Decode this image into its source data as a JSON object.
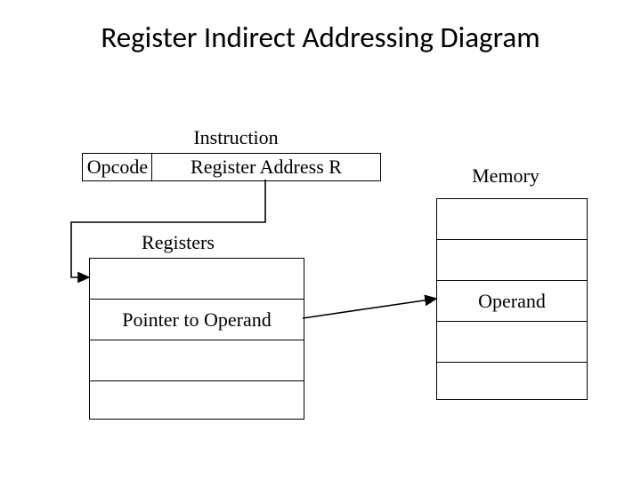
{
  "title": "Register Indirect Addressing Diagram",
  "labels": {
    "instruction": "Instruction",
    "registers": "Registers",
    "memory": "Memory"
  },
  "instruction": {
    "opcode": "Opcode",
    "regaddr": "Register Address R"
  },
  "register_cell_label": "Pointer to Operand",
  "memory_cell_label": "Operand",
  "chart_data": {
    "type": "diagram",
    "title": "Register Indirect Addressing Diagram",
    "nodes": [
      {
        "id": "instruction",
        "label": "Instruction",
        "fields": [
          "Opcode",
          "Register Address R"
        ]
      },
      {
        "id": "registers",
        "label": "Registers",
        "cells": [
          "",
          "Pointer to Operand",
          "",
          ""
        ]
      },
      {
        "id": "memory",
        "label": "Memory",
        "cells": [
          "",
          "",
          "Operand",
          "",
          ""
        ]
      }
    ],
    "edges": [
      {
        "from": "instruction.Register Address R",
        "to": "registers"
      },
      {
        "from": "registers.Pointer to Operand",
        "to": "memory.Operand"
      }
    ]
  }
}
